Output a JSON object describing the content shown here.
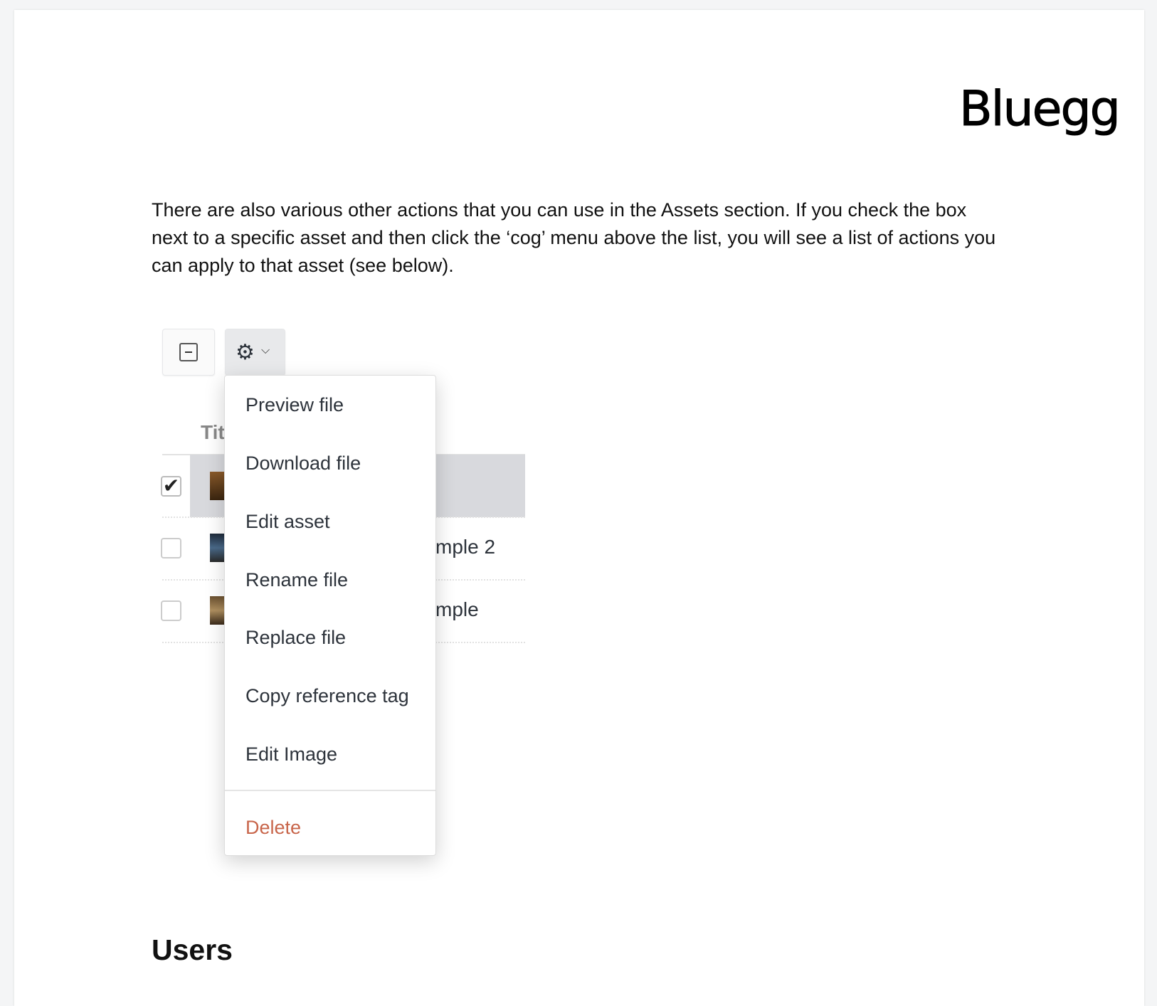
{
  "logo": "Bluegg",
  "intro": "There are also various other actions that you can use in the Assets section. If you check the box next to a specific asset and then click the ‘cog’ menu above the list, you will see a list of actions you can apply to that asset (see below).",
  "toolbar": {
    "select_icon": "minus-checkbox-icon",
    "cog_icon": "⚙",
    "chevron_icon": "⌵"
  },
  "table": {
    "header": "Tit",
    "rows": [
      {
        "checked": true,
        "title": ""
      },
      {
        "checked": false,
        "title": "mple 2"
      },
      {
        "checked": false,
        "title": "mple"
      }
    ]
  },
  "menu": {
    "items": [
      "Preview file",
      "Download file",
      "Edit asset",
      "Rename file",
      "Replace file",
      "Copy reference tag",
      "Edit Image"
    ],
    "delete": "Delete",
    "delete_color": "#c8654a"
  },
  "section_heading": "Users"
}
